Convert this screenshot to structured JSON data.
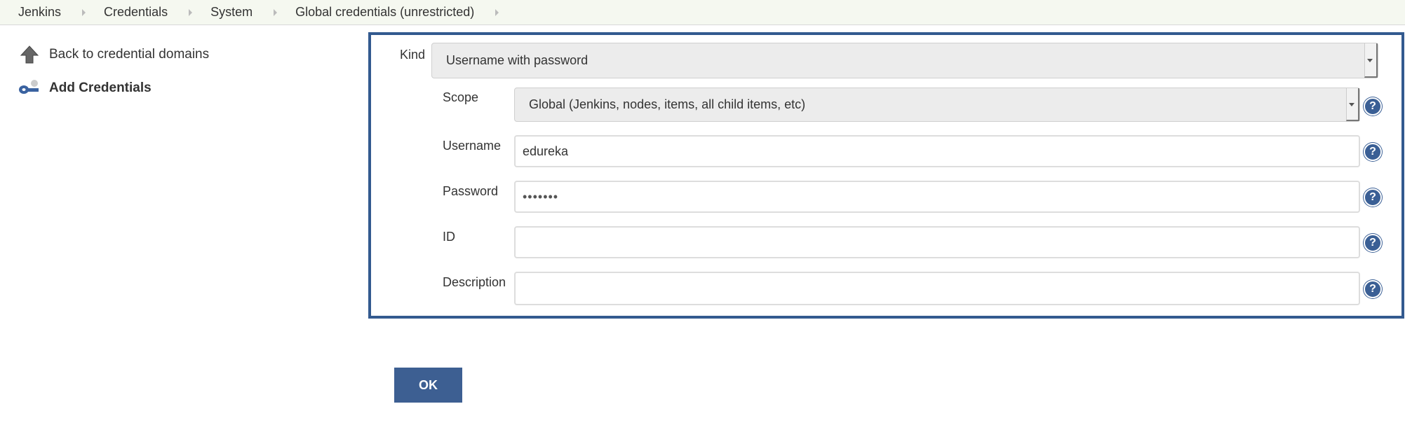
{
  "breadcrumb": [
    "Jenkins",
    "Credentials",
    "System",
    "Global credentials (unrestricted)"
  ],
  "sidebar": {
    "back_label": "Back to credential domains",
    "add_label": "Add Credentials"
  },
  "form": {
    "kind": {
      "label": "Kind",
      "value": "Username with password"
    },
    "scope": {
      "label": "Scope",
      "value": "Global (Jenkins, nodes, items, all child items, etc)"
    },
    "username": {
      "label": "Username",
      "value": "edureka"
    },
    "password": {
      "label": "Password",
      "value": "•••••••"
    },
    "id": {
      "label": "ID",
      "value": ""
    },
    "description": {
      "label": "Description",
      "value": ""
    },
    "help_glyph": "?"
  },
  "ok_label": "OK",
  "colors": {
    "accent": "#335a8f",
    "button": "#3d5f92"
  }
}
